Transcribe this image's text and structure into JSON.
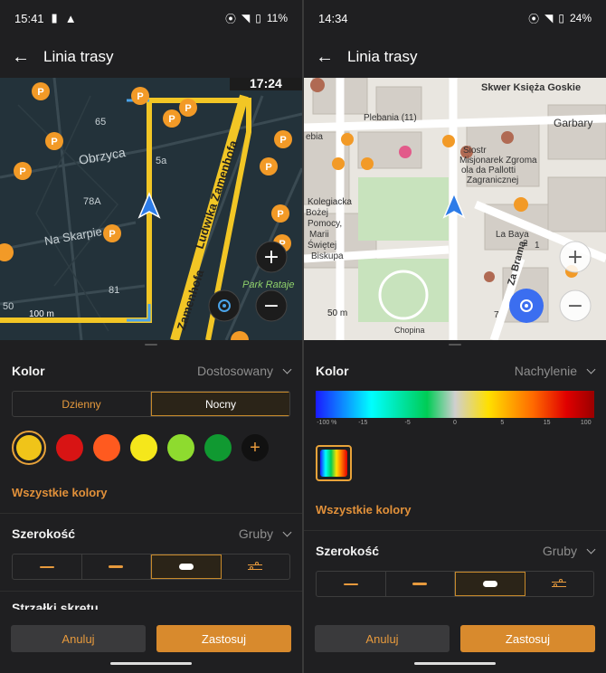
{
  "left": {
    "status": {
      "time": "15:41",
      "battery": "11%"
    },
    "title": "Linia trasy",
    "map": {
      "streets": [
        "Obrzyca",
        "Na Skarpie",
        "Zamenhofa",
        "Ludwika Zamenhofa"
      ],
      "numbers": [
        "65",
        "5a",
        "78A",
        "81",
        "50"
      ],
      "park_label": "Park Rataje",
      "scale": "100 m",
      "clock": "17:24"
    },
    "color_label": "Kolor",
    "color_value": "Dostosowany",
    "day_tab": "Dzienny",
    "night_tab": "Nocny",
    "swatch_colors": [
      "#f0c419",
      "#d81414",
      "#ff5a1f",
      "#f5e71b",
      "#8edb2f",
      "#109931"
    ],
    "add_icon": "+",
    "all_colors": "Wszystkie kolory",
    "width_label": "Szerokość",
    "width_value": "Gruby",
    "next_row": "Strzałki skrętu",
    "cancel": "Anuluj",
    "apply": "Zastosuj"
  },
  "right": {
    "status": {
      "time": "14:34",
      "battery": "24%"
    },
    "title": "Linia trasy",
    "map": {
      "places": [
        "Plebania (11)",
        "Siostr",
        "Misjonarek Zgroma",
        "ola da Pallotti",
        "Zagranicznej",
        "Garbary",
        "Skwer Księża Goskie",
        "Kolegiacka",
        "Bożej",
        "Pomocy,",
        "Marii",
        "Świętej",
        "Biskupa",
        "ebia",
        "La Baya",
        "Za Bramą",
        "Chopina"
      ],
      "scale": "50 m",
      "numbers": [
        "2",
        "1",
        "7"
      ]
    },
    "color_label": "Kolor",
    "color_value": "Nachylenie",
    "gradient_ticks": [
      "-100 %",
      "-15",
      "-5",
      "0",
      "5",
      "15",
      "100"
    ],
    "all_colors": "Wszystkie kolory",
    "width_label": "Szerokość",
    "width_value": "Gruby",
    "cancel": "Anuluj",
    "apply": "Zastosuj"
  }
}
